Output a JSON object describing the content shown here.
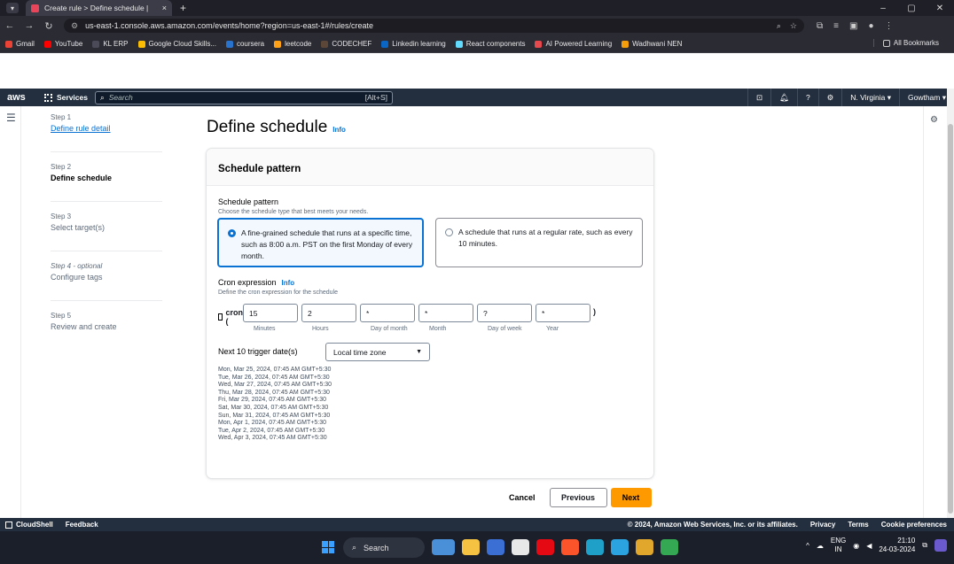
{
  "browser": {
    "tab_title": "Create rule > Define schedule |",
    "tab_close": "×",
    "new_tab": "+",
    "url": "us-east-1.console.aws.amazon.com/events/home?region=us-east-1#/rules/create",
    "window_controls": [
      "–",
      "▢",
      "✕"
    ],
    "bookmarks": [
      {
        "label": "Gmail",
        "color": "#ea4335"
      },
      {
        "label": "YouTube",
        "color": "#ff0000"
      },
      {
        "label": "KL ERP",
        "color": "#4a4a58"
      },
      {
        "label": "Google Cloud Skills...",
        "color": "#fbbc04"
      },
      {
        "label": "coursera",
        "color": "#2a73cc"
      },
      {
        "label": "leetcode",
        "color": "#ffa116"
      },
      {
        "label": "CODECHEF",
        "color": "#5b4638"
      },
      {
        "label": "Linkedin learning",
        "color": "#0a66c2"
      },
      {
        "label": "React components",
        "color": "#61dafb"
      },
      {
        "label": "AI Powered Learning",
        "color": "#e5484d"
      },
      {
        "label": "Wadhwani NEN",
        "color": "#f59e0b"
      }
    ],
    "all_bookmarks": "All Bookmarks"
  },
  "aws_nav": {
    "logo": "aws",
    "services": "Services",
    "search_placeholder": "Search",
    "search_shortcut": "[Alt+S]",
    "region": "N. Virginia ▾",
    "user": "Gowtham ▾"
  },
  "steps": [
    {
      "num": "Step 1",
      "name": "Define rule detail",
      "state": "link"
    },
    {
      "num": "Step 2",
      "name": "Define schedule",
      "state": "active"
    },
    {
      "num": "Step 3",
      "name": "Select target(s)",
      "state": "inactive"
    },
    {
      "num": "Step 4 - optional",
      "name": "Configure tags",
      "state": "inactive"
    },
    {
      "num": "Step 5",
      "name": "Review and create",
      "state": "inactive"
    }
  ],
  "page": {
    "title": "Define schedule",
    "info": "Info"
  },
  "panel": {
    "header": "Schedule pattern",
    "pattern_label": "Schedule pattern",
    "pattern_desc": "Choose the schedule type that best meets your needs.",
    "option_fine": "A fine-grained schedule that runs at a specific time, such as 8:00 a.m. PST on the first Monday of every month.",
    "option_rate": "A schedule that runs at a regular rate, such as every 10 minutes.",
    "cron_label": "Cron expression",
    "cron_info": "Info",
    "cron_desc": "Define the cron expression for the schedule",
    "cron_prefix": "cron (",
    "cron_suffix": ")",
    "cron_fields": [
      {
        "value": "15",
        "label": "Minutes"
      },
      {
        "value": "2",
        "label": "Hours"
      },
      {
        "value": "*",
        "label": "Day of month"
      },
      {
        "value": "*",
        "label": "Month"
      },
      {
        "value": "?",
        "label": "Day of week"
      },
      {
        "value": "*",
        "label": "Year"
      }
    ],
    "next_label": "Next 10 trigger date(s)",
    "timezone": "Local time zone",
    "dates": [
      "Mon, Mar 25, 2024, 07:45 AM GMT+5:30",
      "Tue, Mar 26, 2024, 07:45 AM GMT+5:30",
      "Wed, Mar 27, 2024, 07:45 AM GMT+5:30",
      "Thu, Mar 28, 2024, 07:45 AM GMT+5:30",
      "Fri, Mar 29, 2024, 07:45 AM GMT+5:30",
      "Sat, Mar 30, 2024, 07:45 AM GMT+5:30",
      "Sun, Mar 31, 2024, 07:45 AM GMT+5:30",
      "Mon, Apr 1, 2024, 07:45 AM GMT+5:30",
      "Tue, Apr 2, 2024, 07:45 AM GMT+5:30",
      "Wed, Apr 3, 2024, 07:45 AM GMT+5:30"
    ]
  },
  "actions": {
    "cancel": "Cancel",
    "previous": "Previous",
    "next": "Next"
  },
  "footer": {
    "cloudshell": "CloudShell",
    "feedback": "Feedback",
    "copyright": "© 2024, Amazon Web Services, Inc. or its affiliates.",
    "privacy": "Privacy",
    "terms": "Terms",
    "cookies": "Cookie preferences"
  },
  "taskbar": {
    "search": "Search",
    "lang_top": "ENG",
    "lang_bottom": "IN",
    "time": "21:10",
    "date": "24-03-2024"
  }
}
